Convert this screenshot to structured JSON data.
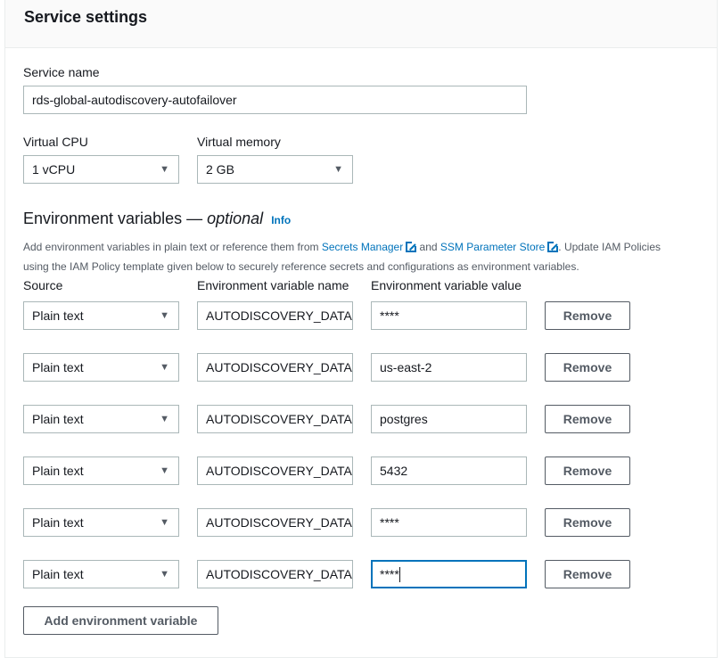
{
  "title": "Service settings",
  "service_name": {
    "label": "Service name",
    "value": "rds-global-autodiscovery-autofailover"
  },
  "vcpu": {
    "label": "Virtual CPU",
    "value": "1 vCPU"
  },
  "memory": {
    "label": "Virtual memory",
    "value": "2 GB"
  },
  "env": {
    "heading": "Environment variables",
    "dash": " — ",
    "optional": "optional",
    "info": "Info",
    "desc1": "Add environment variables in plain text or reference them from ",
    "secrets_link": "Secrets Manager",
    "and": " and ",
    "ssm_link": "SSM Parameter Store",
    "desc2": ". Update IAM Policies",
    "desc3": "using the IAM Policy template given below to securely reference secrets and configurations as environment variables.",
    "col_source": "Source",
    "col_name": "Environment variable name",
    "col_value": "Environment variable value",
    "rows": [
      {
        "source": "Plain text",
        "name": "AUTODISCOVERY_DATAS",
        "value": "****",
        "remove": "Remove"
      },
      {
        "source": "Plain text",
        "name": "AUTODISCOVERY_DATAS",
        "value": "us-east-2",
        "remove": "Remove"
      },
      {
        "source": "Plain text",
        "name": "AUTODISCOVERY_DATAS",
        "value": "postgres",
        "remove": "Remove"
      },
      {
        "source": "Plain text",
        "name": "AUTODISCOVERY_DATAS",
        "value": "5432",
        "remove": "Remove"
      },
      {
        "source": "Plain text",
        "name": "AUTODISCOVERY_DATAS",
        "value": "****",
        "remove": "Remove"
      },
      {
        "source": "Plain text",
        "name": "AUTODISCOVERY_DATAS",
        "value": "****",
        "remove": "Remove"
      }
    ],
    "add_button": "Add environment variable"
  },
  "colors": {
    "accent": "#0073bb",
    "border": "#aab7b8"
  }
}
